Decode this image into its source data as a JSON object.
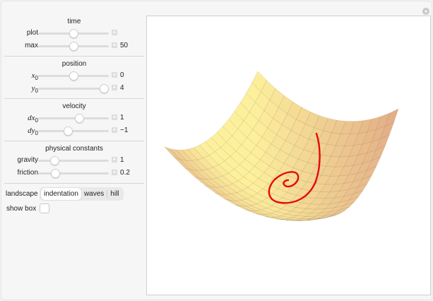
{
  "sections": [
    {
      "title": "time",
      "controls": [
        {
          "label": "plot",
          "value": "",
          "fraction": 0.5
        },
        {
          "label": "max",
          "value": "50",
          "fraction": 0.5
        }
      ]
    },
    {
      "title": "position",
      "controls": [
        {
          "label": "x",
          "sub": "0",
          "value": "0",
          "fraction": 0.5
        },
        {
          "label": "y",
          "sub": "0",
          "value": "4",
          "fraction": 0.93
        }
      ]
    },
    {
      "title": "velocity",
      "controls": [
        {
          "label": "dx",
          "sub": "0",
          "value": "1",
          "fraction": 0.58
        },
        {
          "label": "dy",
          "sub": "0",
          "value": "−1",
          "fraction": 0.42
        }
      ]
    },
    {
      "title": "physical constants",
      "controls": [
        {
          "label": "gravity",
          "value": "1",
          "fraction": 0.23
        },
        {
          "label": "friction",
          "value": "0.2",
          "fraction": 0.24
        }
      ]
    }
  ],
  "landscape": {
    "label": "landscape",
    "options": [
      "indentation",
      "waves",
      "hill"
    ],
    "selected": "indentation"
  },
  "show_box": {
    "label": "show box",
    "checked": false
  },
  "colors": {
    "surface_light": "#fdf09c",
    "surface_dark": "#e3ae86",
    "trajectory": "#e8080a"
  }
}
